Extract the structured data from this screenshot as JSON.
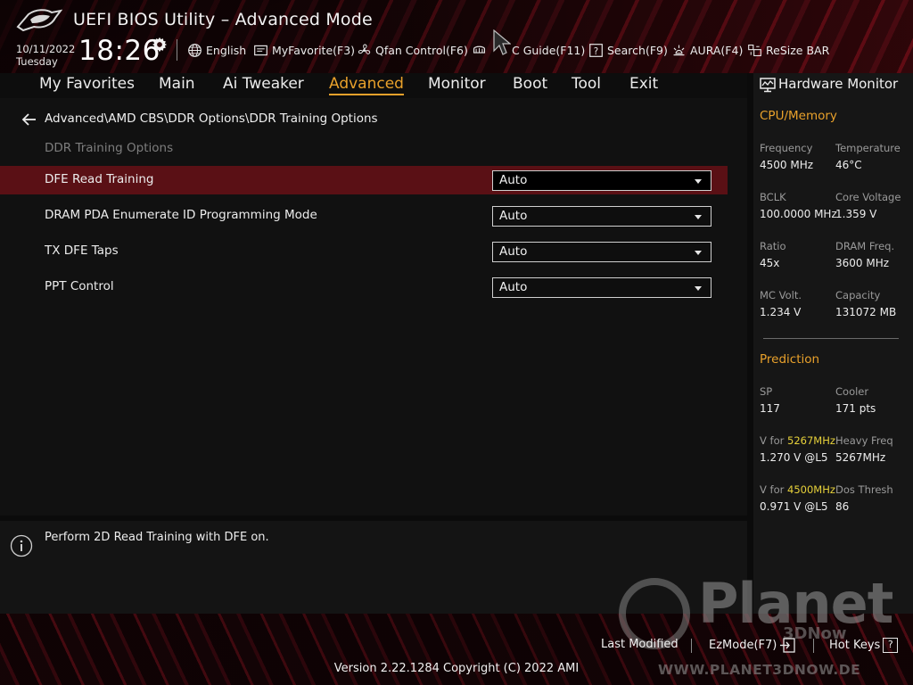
{
  "header": {
    "title": "UEFI BIOS Utility – Advanced Mode",
    "date": "10/11/2022",
    "day": "Tuesday",
    "time": "18:26"
  },
  "toolbar": [
    {
      "label": "English",
      "icon": "globe-icon"
    },
    {
      "label": "MyFavorite(F3)",
      "icon": "favorite-icon"
    },
    {
      "label": "Qfan Control(F6)",
      "icon": "fan-icon"
    },
    {
      "label": "AI OC Guide(F11)",
      "visible_label": "C Guide(F11)",
      "icon": "oc-guide-icon"
    },
    {
      "label": "Search(F9)",
      "icon": "search-icon"
    },
    {
      "label": "AURA(F4)",
      "icon": "aura-icon"
    },
    {
      "label": "ReSize BAR",
      "icon": "resize-bar-icon"
    }
  ],
  "tabs": [
    {
      "label": "My Favorites",
      "active": false
    },
    {
      "label": "Main",
      "active": false
    },
    {
      "label": "Ai Tweaker",
      "active": false
    },
    {
      "label": "Advanced",
      "active": true
    },
    {
      "label": "Monitor",
      "active": false
    },
    {
      "label": "Boot",
      "active": false
    },
    {
      "label": "Tool",
      "active": false
    },
    {
      "label": "Exit",
      "active": false
    }
  ],
  "main": {
    "breadcrumb": "Advanced\\AMD CBS\\DDR Options\\DDR Training Options",
    "section_title": "DDR Training Options",
    "settings": [
      {
        "label": "DFE Read Training",
        "value": "Auto",
        "selected": true
      },
      {
        "label": "DRAM PDA Enumerate ID Programming Mode",
        "value": "Auto",
        "selected": false
      },
      {
        "label": "TX DFE Taps",
        "value": "Auto",
        "selected": false
      },
      {
        "label": "PPT Control",
        "value": "Auto",
        "selected": false
      }
    ]
  },
  "help": {
    "text": "Perform 2D Read Training with DFE on."
  },
  "hardware_monitor": {
    "title": "Hardware Monitor",
    "cpu_memory": {
      "title": "CPU/Memory",
      "items": [
        {
          "label": "Frequency",
          "value": "4500 MHz"
        },
        {
          "label": "Temperature",
          "value": "46°C"
        },
        {
          "label": "BCLK",
          "value": "100.0000 MHz"
        },
        {
          "label": "Core Voltage",
          "value": "1.359 V"
        },
        {
          "label": "Ratio",
          "value": "45x"
        },
        {
          "label": "DRAM Freq.",
          "value": "3600 MHz"
        },
        {
          "label": "MC Volt.",
          "value": "1.234 V"
        },
        {
          "label": "Capacity",
          "value": "131072 MB"
        }
      ]
    },
    "prediction": {
      "title": "Prediction",
      "sp_label": "SP",
      "sp_value": "117",
      "cooler_label": "Cooler",
      "cooler_value": "171 pts",
      "v1_label_prefix": "V for ",
      "v1_freq": "5267MHz",
      "v1_value": "1.270 V @L5",
      "heavy_label": "Heavy Freq",
      "heavy_value": "5267MHz",
      "v2_label_prefix": "V for ",
      "v2_freq": "4500MHz",
      "v2_value": "0.971 V @L5",
      "dos_label": "Dos Thresh",
      "dos_value": "86"
    }
  },
  "footer": {
    "last_modified": "Last Modified",
    "ezmode": "EzMode(F7)",
    "hotkeys": "Hot Keys",
    "hotkeys_key": "?",
    "version": "Version 2.22.1284 Copyright (C) 2022 AMI"
  },
  "watermark": {
    "word": "Planet",
    "sub": "3DNow",
    "url": "WWW.PLANET3DNOW.DE"
  },
  "colors": {
    "accent": "#e9a12b",
    "highlight": "#e7d13a",
    "selection": "#5a1015"
  }
}
